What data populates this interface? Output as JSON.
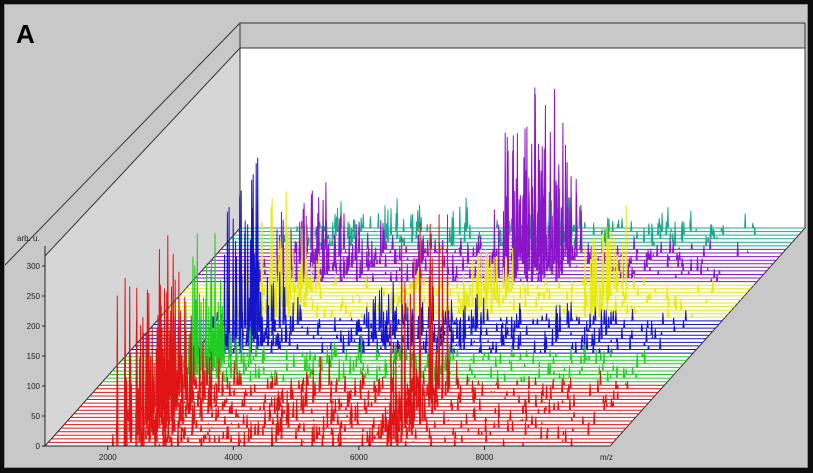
{
  "panel": {
    "letter": "A"
  },
  "chart_data": {
    "type": "line",
    "subtype": "stacked-3d-waterfall",
    "ylabel": "arb. u.",
    "xlabel": "m/z",
    "x_ticks": [
      "2000",
      "4000",
      "6000",
      "8000"
    ],
    "y_ticks": [
      "0",
      "50",
      "100",
      "150",
      "200",
      "250",
      "300"
    ],
    "xlim": [
      1000,
      10000
    ],
    "ylim": [
      0,
      320
    ],
    "grid": false,
    "legend": "none",
    "series": [
      {
        "color": "#e01414",
        "spectra_count": 18,
        "peaks": [
          {
            "x": 2150,
            "y": 250
          },
          {
            "x": 2250,
            "y": 180
          },
          {
            "x": 2350,
            "y": 120
          },
          {
            "x": 2450,
            "y": 200
          },
          {
            "x": 2550,
            "y": 140
          },
          {
            "x": 2700,
            "y": 90
          },
          {
            "x": 2850,
            "y": 60
          },
          {
            "x": 3100,
            "y": 40
          },
          {
            "x": 4200,
            "y": 30
          },
          {
            "x": 4600,
            "y": 55
          },
          {
            "x": 5200,
            "y": 35
          },
          {
            "x": 5600,
            "y": 30
          },
          {
            "x": 6200,
            "y": 40
          },
          {
            "x": 6400,
            "y": 70
          },
          {
            "x": 6500,
            "y": 330
          },
          {
            "x": 6650,
            "y": 55
          }
        ]
      },
      {
        "color": "#22cc22",
        "spectra_count": 8,
        "peaks": [
          {
            "x": 2300,
            "y": 170
          },
          {
            "x": 2450,
            "y": 240
          },
          {
            "x": 2550,
            "y": 150
          },
          {
            "x": 2700,
            "y": 110
          },
          {
            "x": 3000,
            "y": 60
          },
          {
            "x": 4300,
            "y": 30
          },
          {
            "x": 4800,
            "y": 45
          },
          {
            "x": 5400,
            "y": 30
          },
          {
            "x": 6300,
            "y": 35
          }
        ]
      },
      {
        "color": "#1414c8",
        "spectra_count": 10,
        "peaks": [
          {
            "x": 2500,
            "y": 220
          },
          {
            "x": 2650,
            "y": 280
          },
          {
            "x": 2800,
            "y": 160
          },
          {
            "x": 3000,
            "y": 90
          },
          {
            "x": 3300,
            "y": 50
          },
          {
            "x": 4400,
            "y": 35
          },
          {
            "x": 4700,
            "y": 70
          },
          {
            "x": 5000,
            "y": 60
          },
          {
            "x": 5400,
            "y": 75
          },
          {
            "x": 5700,
            "y": 40
          },
          {
            "x": 6200,
            "y": 55
          },
          {
            "x": 6800,
            "y": 35
          },
          {
            "x": 7600,
            "y": 50
          },
          {
            "x": 8300,
            "y": 45
          }
        ]
      },
      {
        "color": "#e8e814",
        "spectra_count": 10,
        "peaks": [
          {
            "x": 2600,
            "y": 180
          },
          {
            "x": 2800,
            "y": 110
          },
          {
            "x": 3000,
            "y": 60
          },
          {
            "x": 4600,
            "y": 30
          },
          {
            "x": 5800,
            "y": 80
          },
          {
            "x": 6000,
            "y": 100
          },
          {
            "x": 6200,
            "y": 70
          },
          {
            "x": 7800,
            "y": 120
          },
          {
            "x": 7900,
            "y": 140
          }
        ]
      },
      {
        "color": "#8a14c8",
        "spectra_count": 10,
        "peaks": [
          {
            "x": 2400,
            "y": 110
          },
          {
            "x": 2700,
            "y": 130
          },
          {
            "x": 3000,
            "y": 90
          },
          {
            "x": 3300,
            "y": 70
          },
          {
            "x": 3600,
            "y": 60
          },
          {
            "x": 4400,
            "y": 40
          },
          {
            "x": 5100,
            "y": 35
          },
          {
            "x": 5800,
            "y": 120
          },
          {
            "x": 5950,
            "y": 240
          },
          {
            "x": 6050,
            "y": 300
          },
          {
            "x": 6150,
            "y": 200
          },
          {
            "x": 6300,
            "y": 280
          },
          {
            "x": 6450,
            "y": 160
          },
          {
            "x": 6600,
            "y": 230
          },
          {
            "x": 6750,
            "y": 120
          }
        ]
      },
      {
        "color": "#1aa88c",
        "spectra_count": 6,
        "peaks": [
          {
            "x": 2600,
            "y": 60
          },
          {
            "x": 3000,
            "y": 45
          },
          {
            "x": 3500,
            "y": 70
          },
          {
            "x": 3900,
            "y": 40
          },
          {
            "x": 4600,
            "y": 55
          },
          {
            "x": 5800,
            "y": 50
          },
          {
            "x": 6100,
            "y": 90
          },
          {
            "x": 6400,
            "y": 70
          },
          {
            "x": 7000,
            "y": 30
          },
          {
            "x": 7800,
            "y": 50
          },
          {
            "x": 8200,
            "y": 40
          }
        ]
      }
    ]
  }
}
